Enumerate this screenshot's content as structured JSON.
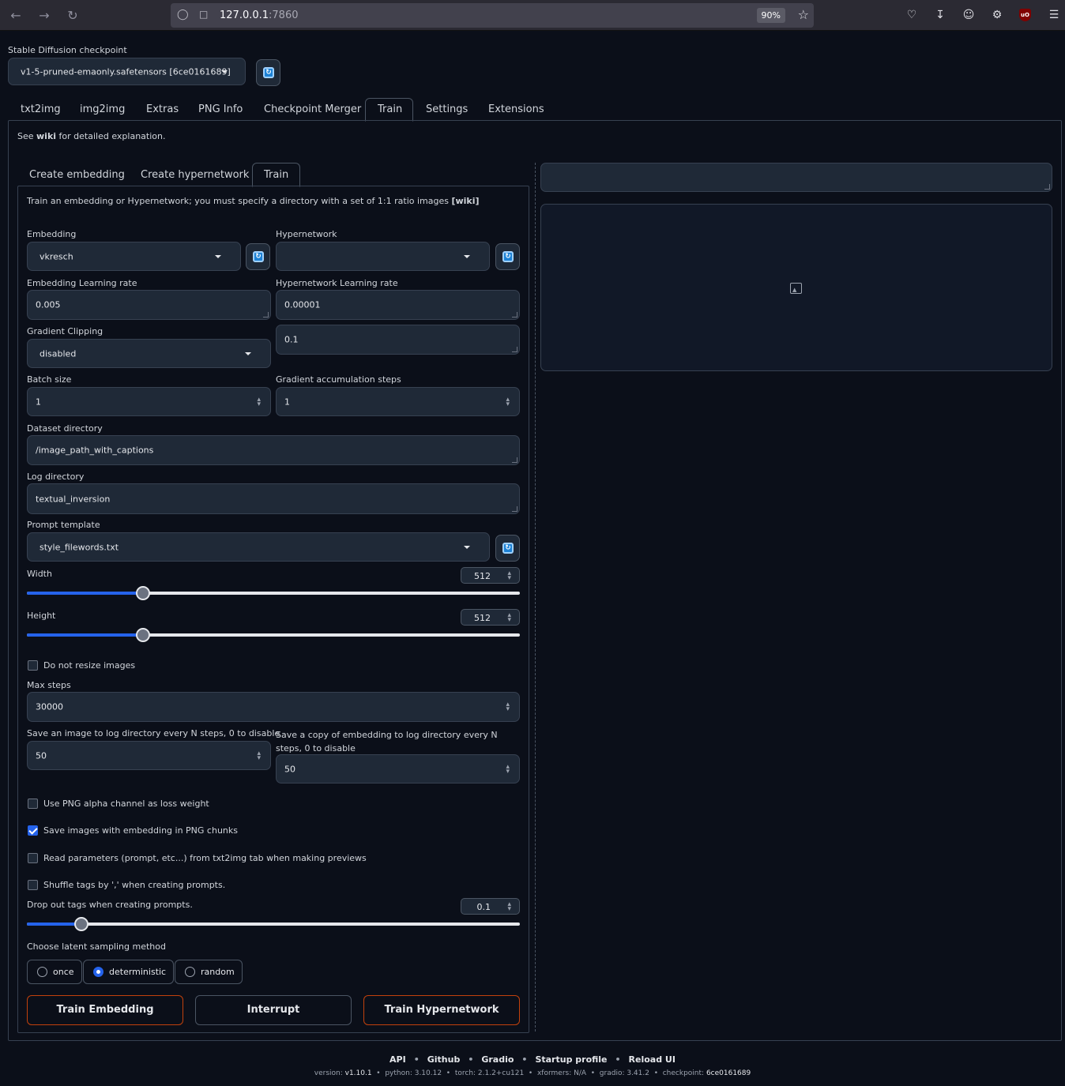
{
  "browser": {
    "url_host": "127.0.0.1",
    "url_port": ":7860",
    "zoom": "90%"
  },
  "checkpoint": {
    "label": "Stable Diffusion checkpoint",
    "value": "v1-5-pruned-emaonly.safetensors [6ce0161689]"
  },
  "main_tabs": [
    "txt2img",
    "img2img",
    "Extras",
    "PNG Info",
    "Checkpoint Merger",
    "Train",
    "Settings",
    "Extensions"
  ],
  "active_main_tab": "Train",
  "wiki_note": {
    "prefix": "See ",
    "link": "wiki",
    "suffix": " for detailed explanation."
  },
  "sub_tabs": [
    "Create embedding",
    "Create hypernetwork",
    "Train"
  ],
  "active_sub_tab": "Train",
  "train": {
    "intro": {
      "text": "Train an embedding or Hypernetwork; you must specify a directory with a set of 1:1 ratio images ",
      "link": "[wiki]"
    },
    "embedding_label": "Embedding",
    "embedding_value": "vkresch",
    "hypernetwork_label": "Hypernetwork",
    "hypernetwork_value": "",
    "emb_lr_label": "Embedding Learning rate",
    "emb_lr_value": "0.005",
    "hn_lr_label": "Hypernetwork Learning rate",
    "hn_lr_value": "0.00001",
    "grad_clip_label": "Gradient Clipping",
    "grad_clip_value": "disabled",
    "grad_clip_amount": "0.1",
    "batch_label": "Batch size",
    "batch_value": "1",
    "grad_accum_label": "Gradient accumulation steps",
    "grad_accum_value": "1",
    "dataset_label": "Dataset directory",
    "dataset_value": "/image_path_with_captions",
    "logdir_label": "Log directory",
    "logdir_value": "textual_inversion",
    "template_label": "Prompt template",
    "template_value": "style_filewords.txt",
    "width_label": "Width",
    "width_value": "512",
    "width_fraction": 0.236,
    "height_label": "Height",
    "height_value": "512",
    "height_fraction": 0.236,
    "no_resize_label": "Do not resize images",
    "no_resize_checked": false,
    "max_steps_label": "Max steps",
    "max_steps_value": "30000",
    "save_image_label": "Save an image to log directory every N steps, 0 to disable",
    "save_image_value": "50",
    "save_emb_label": "Save a copy of embedding to log directory every N steps, 0 to disable",
    "save_emb_value": "50",
    "png_alpha_label": "Use PNG alpha channel as loss weight",
    "png_alpha_checked": false,
    "png_chunks_label": "Save images with embedding in PNG chunks",
    "png_chunks_checked": true,
    "read_params_label": "Read parameters (prompt, etc...) from txt2img tab when making previews",
    "read_params_checked": false,
    "shuffle_label": "Shuffle tags by ',' when creating prompts.",
    "shuffle_checked": false,
    "dropout_label": "Drop out tags when creating prompts.",
    "dropout_value": "0.1",
    "dropout_fraction": 0.11,
    "latent_label": "Choose latent sampling method",
    "latent_options": [
      "once",
      "deterministic",
      "random"
    ],
    "latent_selected": "deterministic",
    "btn_train_embedding": "Train Embedding",
    "btn_interrupt": "Interrupt",
    "btn_train_hypernetwork": "Train Hypernetwork"
  },
  "footer": {
    "links": [
      "API",
      "Github",
      "Gradio",
      "Startup profile",
      "Reload UI"
    ],
    "version_label": "version: ",
    "version": "v1.10.1",
    "python": "python: 3.10.12",
    "torch": "torch: 2.1.2+cu121",
    "xformers": "xformers: N/A",
    "gradio": "gradio: 3.41.2",
    "checkpoint_label": "checkpoint: ",
    "checkpoint": "6ce0161689"
  },
  "colors": {
    "accent": "#2563eb",
    "primary_border": "#c2410c",
    "background": "#0b0f19"
  }
}
